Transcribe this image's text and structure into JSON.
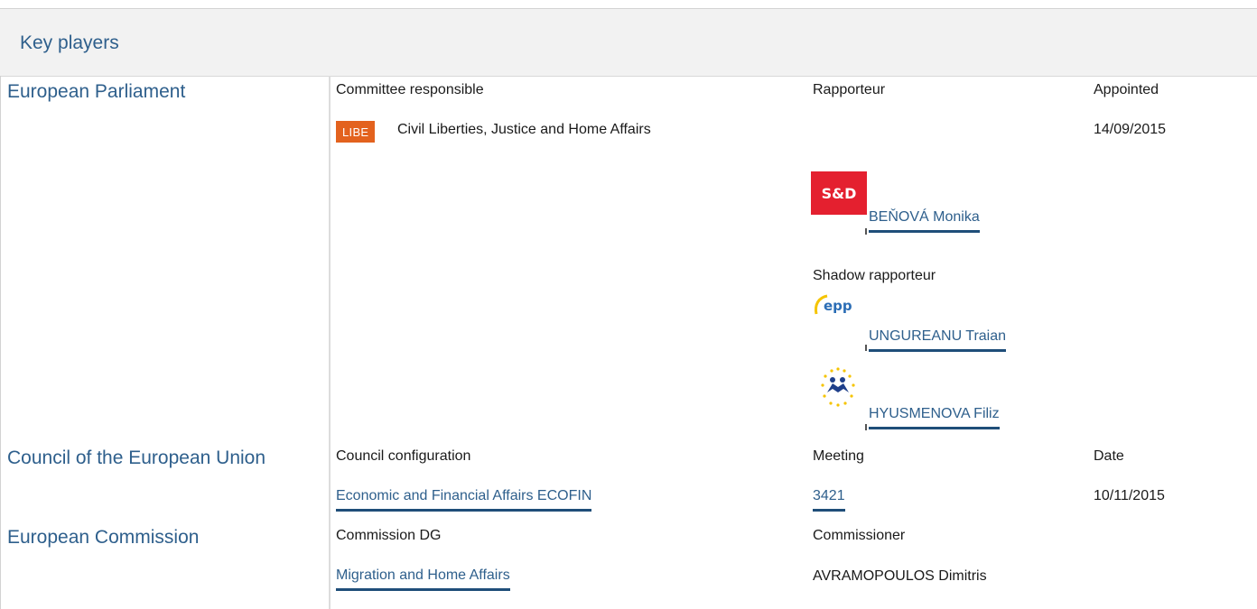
{
  "header": {
    "title": "Key players"
  },
  "parliament": {
    "title": "European Parliament",
    "col_committee": "Committee responsible",
    "col_rapporteur": "Rapporteur",
    "col_appointed": "Appointed",
    "committee_badge": "LIBE",
    "committee_name": "Civil Liberties, Justice and Home Affairs",
    "appointed_date": "14/09/2015",
    "rapporteur": {
      "group_logo": "S&D",
      "group_color": "#e4202f",
      "name": "BEŇOVÁ Monika"
    },
    "shadow_label": "Shadow rapporteur",
    "shadows": [
      {
        "group_logo": "epp",
        "group_color": "#2b6db5",
        "name": "UNGUREANU Traian"
      },
      {
        "group_logo": "alde-stars",
        "group_color": "#f5c400",
        "name": "HYUSMENOVA Filiz"
      }
    ]
  },
  "council": {
    "title": "Council of the European Union",
    "col_config": "Council configuration",
    "col_meeting": "Meeting",
    "col_date": "Date",
    "config": "Economic and Financial Affairs ECOFIN",
    "meeting": "3421",
    "date": "10/11/2015"
  },
  "commission": {
    "title": "European Commission",
    "col_dg": "Commission DG",
    "col_commissioner": "Commissioner",
    "dg": "Migration and Home Affairs",
    "commissioner": "AVRAMOPOULOS Dimitris"
  },
  "colors": {
    "link": "#2e5f8c",
    "underline": "#1f4e79",
    "badge": "#e3621e",
    "header_bg": "#f2f2f2"
  }
}
